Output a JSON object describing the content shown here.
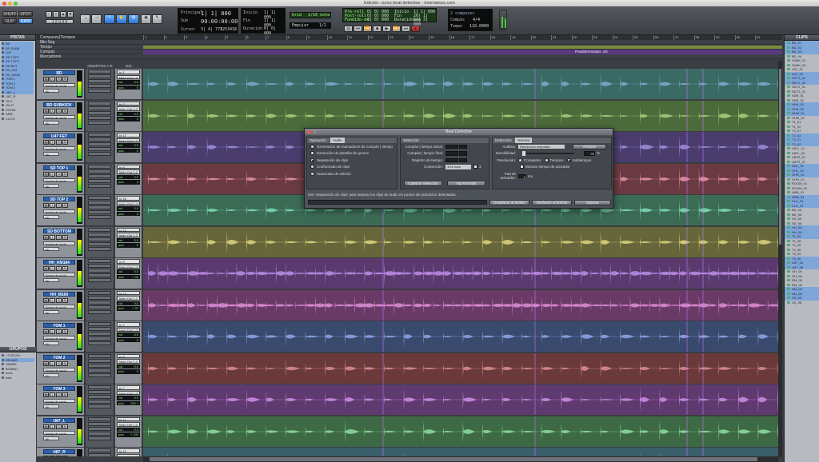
{
  "window": {
    "title": "Edición: curso beat detective - tonimatoss.com"
  },
  "topbar": {
    "shuffle": "SHUFFLE",
    "spot": "SPOT",
    "slip": "SLIP",
    "grid": "GRID",
    "main_label": "Principal",
    "main_counter": "1| 1| 000",
    "sub_label": "Sub",
    "sub_counter": "00:00:00:00",
    "start_label": "Inicio",
    "start_val": "1| 1| 000",
    "end_label": "Fin",
    "end_val": "1| 1| 000",
    "length_label": "Duración",
    "length_val": "0| 0| 000",
    "cursor_label": "Cursor",
    "cursor_val": "3| 4| 773",
    "sample_val": "1253418",
    "grid_label": "Grid",
    "grid_val": "1/16 nota",
    "nudge_label": "Empujar",
    "nudge_val": "1/2",
    "preroll_label": "Pre-roll",
    "preroll_val": "0| 0| 000",
    "postroll_label": "Post-roll",
    "postroll_val": "0| 0| 000",
    "fadein_label": "Fundido-en",
    "fadein_val": "0| 0| 000",
    "tr_start": "Inicio",
    "tr_start_val": "1| 1| 000",
    "tr_end": "Fin",
    "tr_end_val": "26| 1| 000",
    "tr_len": "Duración",
    "tr_len_val": "24| 3| 000",
    "compas": "Compás",
    "compas_val": "4/4",
    "tempo_label": "Tempo",
    "tempo_val": "110.0000",
    "sync_label": "2 compases"
  },
  "left_panel": {
    "tracks_title": "PISTAS",
    "groups_title": "GRUPOS",
    "tracks": [
      "BD",
      "BD SUBK",
      "U47",
      "SD TOP1",
      "SD TOP2",
      "SD BOT",
      "HH_KM",
      "HH_M160",
      "TOM 1",
      "TOM 2",
      "TOM 3",
      "U87_L",
      "U87_R",
      "OH L",
      "OH R",
      "ROOM",
      "AMB",
      "CLICK"
    ],
    "groups": [
      "<TODOS>",
      "DRUMS",
      "SNARE",
      "BOMBO",
      "toms",
      "bats"
    ]
  },
  "rulers": {
    "rows": [
      "Compases|Tiempos",
      "Min:Seg",
      "Tempo",
      "Compás",
      "Marcadores"
    ],
    "bars": [
      "1",
      "2",
      "3",
      "4",
      "5",
      "6",
      "7",
      "8",
      "9",
      "10",
      "11",
      "12",
      "13",
      "14",
      "15",
      "16",
      "17",
      "18",
      "19",
      "20",
      "21",
      "22",
      "23",
      "24",
      "25",
      "26",
      "27",
      "28",
      "29",
      "30",
      "31"
    ],
    "marker_label": "Predeterminado: 4/4",
    "col_insert": "INSERTOS A-E",
    "col_io": "E/S"
  },
  "tracks": [
    {
      "name": "BD",
      "input": "In 1",
      "output": "Main Out 1-2",
      "vol": "0.0",
      "pan": "0",
      "color": "#3a6a64"
    },
    {
      "name": "BD SUBKICK",
      "input": "In 2",
      "output": "Main Out 1-2",
      "vol": "0.0",
      "pan": "0",
      "color": "#4c6b3b"
    },
    {
      "name": "U47 FET",
      "input": "In 17",
      "output": "Main Out 1-2",
      "vol": "0.0",
      "pan": "0",
      "color": "#4a3d6e"
    },
    {
      "name": "SD TOP 1",
      "input": "In 5",
      "output": "Main Out 1-2",
      "vol": "0.0",
      "pan": "0",
      "color": "#6a3a42"
    },
    {
      "name": "SD TOP 2",
      "input": "In 16",
      "output": "Main Out 1-2",
      "vol": "0.0",
      "pan": "0",
      "color": "#3b6a55"
    },
    {
      "name": "SD BOTTOM",
      "input": "In 15",
      "output": "Main Out 1-2",
      "vol": "0.0",
      "pan": "0",
      "color": "#66663a"
    },
    {
      "name": "HH_KM184",
      "input": "In 9",
      "output": "Main Out 1-2",
      "vol": "0.0",
      "pan": "< 34",
      "color": "#5a3a6e"
    },
    {
      "name": "HH_M160",
      "input": "In 14",
      "output": "Main Out 1-2",
      "vol": "0.0",
      "pan": "< 37",
      "color": "#6a3a66"
    },
    {
      "name": "TOM 1",
      "input": "In 7",
      "output": "Main Out 1-2",
      "vol": "0.0",
      "pan": "0",
      "color": "#3a4a6e"
    },
    {
      "name": "TOM 2",
      "input": "In 8",
      "output": "Main Out 1-2",
      "vol": "0.0",
      "pan": "0",
      "color": "#6a3a3a"
    },
    {
      "name": "TOM 3",
      "input": "In 7",
      "output": "Main Out 1-2",
      "vol": "0.0",
      "pan": "100 >",
      "color": "#5e3a6e"
    },
    {
      "name": "U87_L",
      "input": "In 11",
      "output": "Main Out 1-2",
      "vol": "0.0",
      "pan": "< 100",
      "color": "#3d6a44"
    },
    {
      "name": "U87_R",
      "input": "In 12",
      "output": "Main Out 1-2",
      "vol": "0.0",
      "pan": "0",
      "color": "#3a5e6a"
    }
  ],
  "track_ui": {
    "view": "forma de onda",
    "sub": "dk.",
    "vol_label": "vol.",
    "pan_label": "pan."
  },
  "dialog": {
    "title": "Beat Detective",
    "op_label": "Operación:",
    "op_val": "Audio",
    "options": [
      {
        "label": "Generación de marcadores de compás | tiempo",
        "selected": false
      },
      {
        "label": "Extracción de plantilla de groove",
        "selected": false
      },
      {
        "label": "Separación de clips",
        "selected": true
      },
      {
        "label": "Conformado de clips",
        "selected": false
      },
      {
        "label": "Suavizado de edición",
        "selected": false
      }
    ],
    "sel_label": "Selección",
    "start_bar": "Compás | tiempo inicial:",
    "end_bar": "Compás | tiempo final:",
    "tempo_reg": "Registro de tiempo:",
    "contains": "Contención:",
    "contains_val": "1/16 nota",
    "contains_num": "3",
    "capture_btn": "Capturar selección",
    "tap_btn": "Tap End B|B",
    "det_label": "Detección:",
    "det_val": "Normal",
    "analysis_label": "Análisis:",
    "analysis_val": "Resolución mejorada",
    "analyze_btn": "Analizar",
    "sens_label": "Sensibilidad:",
    "sens_val": "90",
    "sens_unit": "%",
    "res_label": "Resolución:",
    "res_opts": [
      "Compases",
      "Tiempos",
      "Subtiempos"
    ],
    "res_selected": "Subtiempos",
    "show_trigger": "Mostrar tiempo de activador",
    "pad_label": "Pad de activador:",
    "pad_val": "0",
    "pad_unit": "ms",
    "footer": "Use 'Separación de clips' para separar los clips de audio en puntos de activación detectados.",
    "btn1": "Desplazar al ámbito",
    "btn2": "Deshacer al ámbito",
    "btn3": "Separar"
  },
  "right_panel": {
    "title": "CLIPS",
    "clips": [
      "BD_01",
      "BD_02",
      "BD_03",
      "BD_04",
      "SUBK_01",
      "SUBK_02",
      "U47_01",
      "U47_02",
      "SDT1_01",
      "SDT1_02",
      "SDT2_01",
      "SDT2_02",
      "SDB_01",
      "SDB_02",
      "HHK_01",
      "HHK_02",
      "HHM_01",
      "HHM_02",
      "T1_01",
      "T1_02",
      "T2_01",
      "T2_02",
      "T3_01",
      "T3_02",
      "U87L_01",
      "U87L_02",
      "U87R_01",
      "U87R_02",
      "OHL_01",
      "OHL_02",
      "OHR_01",
      "OHR_02",
      "ROOM_01",
      "ROOM_02",
      "AMB_01",
      "AMB_02",
      "CLK_01",
      "CLK_02",
      "BD_05",
      "BD_06",
      "SD_05",
      "SD_06",
      "HH_05",
      "HH_06",
      "T1_05",
      "T1_06",
      "T2_05",
      "T2_06",
      "T3_05",
      "T3_06",
      "U87_05",
      "U87_06",
      "OH_05",
      "OH_06",
      "RM_05",
      "RM_06",
      "AM_05",
      "AM_06",
      "CK_05",
      "CK_06"
    ]
  },
  "colors": {
    "accent": "#2c74d6",
    "lcd_green": "#a3f08c",
    "marker_bar": "#7a8d3a",
    "marker_label_bg": "#6a3a8e"
  }
}
